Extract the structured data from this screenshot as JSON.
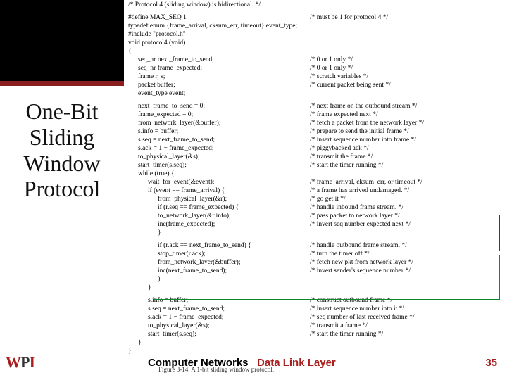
{
  "title_lines": [
    "One-Bit",
    "Sliding",
    "Window",
    "Protocol"
  ],
  "code": {
    "l0": "/* Protocol 4 (sliding window) is bidirectional. */",
    "l1": "#define MAX_SEQ 1",
    "c1": "/* must be 1 for protocol 4 */",
    "l2": "typedef enum {frame_arrival, cksum_err, timeout} event_type;",
    "l3": "#include \"protocol.h\"",
    "l4": "void protocol4 (void)",
    "l5": "{",
    "l6": "seq_nr next_frame_to_send;",
    "c6": "/* 0 or 1 only */",
    "l7": "seq_nr frame_expected;",
    "c7": "/* 0 or 1 only */",
    "l8": "frame r, s;",
    "c8": "/* scratch variables */",
    "l9": "packet buffer;",
    "c9": "/* current packet being sent */",
    "l10": "event_type event;",
    "l11": "next_frame_to_send = 0;",
    "c11": "/* next frame on the outbound stream */",
    "l12": "frame_expected = 0;",
    "c12": "/* frame expected next */",
    "l13": "from_network_layer(&buffer);",
    "c13": "/* fetch a packet from the network layer */",
    "l14": "s.info = buffer;",
    "c14": "/* prepare to send the initial frame */",
    "l15": "s.seq = next_frame_to_send;",
    "c15": "/* insert sequence number into frame */",
    "l16": "s.ack = 1 − frame_expected;",
    "c16": "/* piggybacked ack */",
    "l17": "to_physical_layer(&s);",
    "c17": "/* transmit the frame */",
    "l18": "start_timer(s.seq);",
    "c18": "/* start the timer running */",
    "l19": "while (true) {",
    "l20": "wait_for_event(&event);",
    "c20": "/* frame_arrival, cksum_err, or timeout */",
    "l21": "if (event == frame_arrival) {",
    "c21": "/* a frame has arrived undamaged. */",
    "l22": "from_physical_layer(&r);",
    "c22": "/* go get it */",
    "l23": "if (r.seq == frame_expected) {",
    "c23": "/* handle inbound frame stream. */",
    "l24": "to_network_layer(&r.info);",
    "c24": "/* pass packet to network layer */",
    "l25": "inc(frame_expected);",
    "c25": "/* invert seq number expected next */",
    "l26": "}",
    "l27": "if (r.ack == next_frame_to_send) {",
    "c27": "/* handle outbound frame stream. */",
    "l28": "stop_timer(r.ack);",
    "c28": "/* turn the timer off */",
    "l29": "from_network_layer(&buffer);",
    "c29": "/* fetch new pkt from network layer */",
    "l30": "inc(next_frame_to_send);",
    "c30": "/* invert sender's sequence number */",
    "l31": "}",
    "l32": "}",
    "l33": "s.info = buffer;",
    "c33": "/* construct outbound frame */",
    "l34": "s.seq = next_frame_to_send;",
    "c34": "/* insert sequence number into it */",
    "l35": "s.ack = 1 − frame_expected;",
    "c35": "/* seq number of last received frame */",
    "l36": "to_physical_layer(&s);",
    "c36": "/* transmit a frame */",
    "l37": "start_timer(s.seq);",
    "c37": "/* start the timer running */",
    "l38": "}",
    "l39": "}"
  },
  "footer": {
    "cn": "Computer Networks",
    "dll": "Data Link Layer",
    "caption": "Figure 3-14.  A 1-bit sliding window protocol.",
    "page": "35"
  },
  "logo": {
    "w": "W",
    "p": "P",
    "i": "I"
  }
}
